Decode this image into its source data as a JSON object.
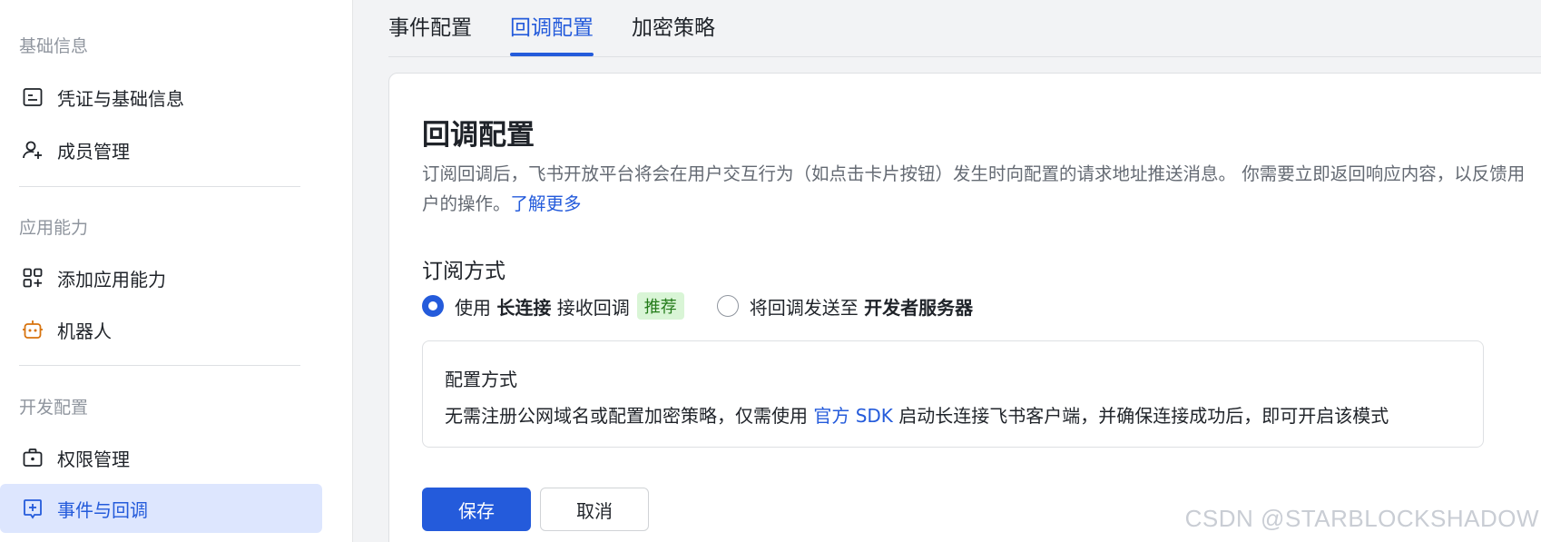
{
  "sidebar": {
    "section_basic": "基础信息",
    "item_credentials": "凭证与基础信息",
    "item_members": "成员管理",
    "section_ability": "应用能力",
    "item_add_ability": "添加应用能力",
    "item_bot": "机器人",
    "section_dev": "开发配置",
    "item_permissions": "权限管理",
    "item_events": "事件与回调"
  },
  "tabs": {
    "event_config": "事件配置",
    "callback_config": "回调配置",
    "encryption": "加密策略"
  },
  "card": {
    "title": "回调配置",
    "description": "订阅回调后，飞书开放平台将会在用户交互行为（如点击卡片按钮）发生时向配置的请求地址推送消息。 你需要立即返回响应内容，以反馈用户的操作。",
    "learn_more": "了解更多",
    "subscription_title": "订阅方式",
    "option1_prefix": "使用 ",
    "option1_bold": "长连接",
    "option1_suffix": " 接收回调",
    "option1_tag": "推荐",
    "option2_prefix": "将回调发送至 ",
    "option2_bold": "开发者服务器",
    "info_title": "配置方式",
    "info_prefix": "无需注册公网域名或配置加密策略，仅需使用 ",
    "info_link": "官方 SDK",
    "info_suffix": " 启动长连接飞书客户端，并确保连接成功后，即可开启该模式",
    "save": "保存",
    "cancel": "取消"
  },
  "watermark": "CSDN @STARBLOCKSHADOW",
  "colors": {
    "accent": "#245bdb",
    "active_bg": "#dde6fe",
    "tag_bg": "#d9f5d6",
    "tag_text": "#237b19",
    "bot_icon": "#d7730e"
  }
}
